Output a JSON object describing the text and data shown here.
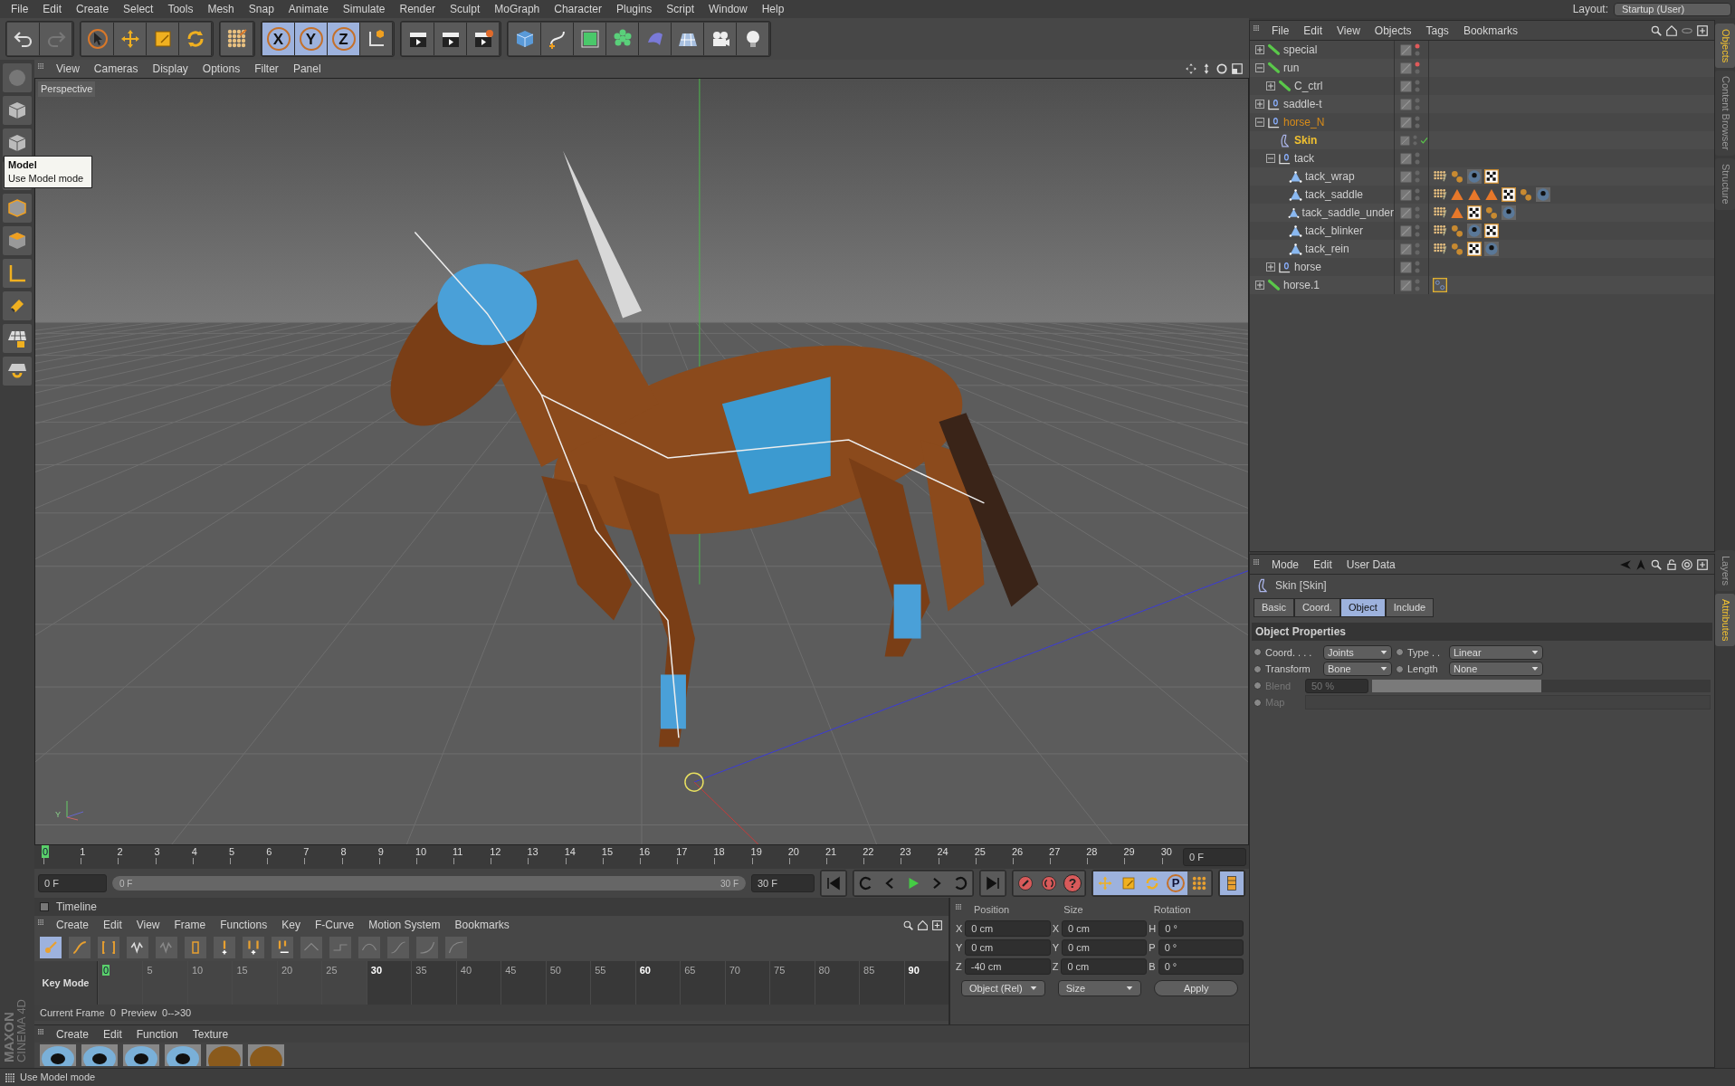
{
  "menu_bar": [
    "File",
    "Edit",
    "Create",
    "Select",
    "Tools",
    "Mesh",
    "Snap",
    "Animate",
    "Simulate",
    "Render",
    "Sculpt",
    "MoGraph",
    "Character",
    "Plugins",
    "Script",
    "Window",
    "Help"
  ],
  "layout": {
    "label": "Layout:",
    "value": "Startup (User)"
  },
  "axis_locks": [
    {
      "label": "X",
      "selected": true
    },
    {
      "label": "Y",
      "selected": true
    },
    {
      "label": "Z",
      "selected": true
    }
  ],
  "tooltip": {
    "title": "Model",
    "text": "Use Model mode"
  },
  "viewport": {
    "menu": [
      "View",
      "Cameras",
      "Display",
      "Options",
      "Filter",
      "Panel"
    ],
    "camera": "Perspective",
    "axis_label": "Y"
  },
  "frame_ruler": {
    "ticks": [
      {
        "label": "0",
        "selected": true
      },
      {
        "label": "1",
        "selected": false
      },
      {
        "label": "2",
        "selected": false
      },
      {
        "label": "3",
        "selected": false
      },
      {
        "label": "4",
        "selected": false
      },
      {
        "label": "5",
        "selected": false
      },
      {
        "label": "6",
        "selected": false
      },
      {
        "label": "7",
        "selected": false
      },
      {
        "label": "8",
        "selected": false
      },
      {
        "label": "9",
        "selected": false
      },
      {
        "label": "10",
        "selected": false
      },
      {
        "label": "11",
        "selected": false
      },
      {
        "label": "12",
        "selected": false
      },
      {
        "label": "13",
        "selected": false
      },
      {
        "label": "14",
        "selected": false
      },
      {
        "label": "15",
        "selected": false
      },
      {
        "label": "16",
        "selected": false
      },
      {
        "label": "17",
        "selected": false
      },
      {
        "label": "18",
        "selected": false
      },
      {
        "label": "19",
        "selected": false
      },
      {
        "label": "20",
        "selected": false
      },
      {
        "label": "21",
        "selected": false
      },
      {
        "label": "22",
        "selected": false
      },
      {
        "label": "23",
        "selected": false
      },
      {
        "label": "24",
        "selected": false
      },
      {
        "label": "25",
        "selected": false
      },
      {
        "label": "26",
        "selected": false
      },
      {
        "label": "27",
        "selected": false
      },
      {
        "label": "28",
        "selected": false
      },
      {
        "label": "29",
        "selected": false
      },
      {
        "label": "30",
        "selected": false
      }
    ],
    "frame": "0 F"
  },
  "range": {
    "start": "0 F",
    "slider_start": "0 F",
    "slider_end": "30 F",
    "level": 1,
    "end": "30 F",
    "help_label": "?",
    "param_label": "P"
  },
  "timeline": {
    "title": "Timeline",
    "menu": [
      "Create",
      "Edit",
      "View",
      "Frame",
      "Functions",
      "Key",
      "F-Curve",
      "Motion System",
      "Bookmarks"
    ],
    "mode": "Key Mode",
    "ticks": [
      {
        "label": "0",
        "selected": true,
        "major": false,
        "in_range": true
      },
      {
        "label": "5",
        "selected": false,
        "major": false,
        "in_range": true
      },
      {
        "label": "10",
        "selected": false,
        "major": false,
        "in_range": true
      },
      {
        "label": "15",
        "selected": false,
        "major": false,
        "in_range": true
      },
      {
        "label": "20",
        "selected": false,
        "major": false,
        "in_range": true
      },
      {
        "label": "25",
        "selected": false,
        "major": false,
        "in_range": true
      },
      {
        "label": "30",
        "selected": false,
        "major": true,
        "in_range": false
      },
      {
        "label": "35",
        "selected": false,
        "major": false,
        "in_range": false
      },
      {
        "label": "40",
        "selected": false,
        "major": false,
        "in_range": false
      },
      {
        "label": "45",
        "selected": false,
        "major": false,
        "in_range": false
      },
      {
        "label": "50",
        "selected": false,
        "major": false,
        "in_range": false
      },
      {
        "label": "55",
        "selected": false,
        "major": false,
        "in_range": false
      },
      {
        "label": "60",
        "selected": false,
        "major": true,
        "in_range": false
      },
      {
        "label": "65",
        "selected": false,
        "major": false,
        "in_range": false
      },
      {
        "label": "70",
        "selected": false,
        "major": false,
        "in_range": false
      },
      {
        "label": "75",
        "selected": false,
        "major": false,
        "in_range": false
      },
      {
        "label": "80",
        "selected": false,
        "major": false,
        "in_range": false
      },
      {
        "label": "85",
        "selected": false,
        "major": false,
        "in_range": false
      },
      {
        "label": "90",
        "selected": false,
        "major": true,
        "in_range": false
      }
    ],
    "status": "Current Frame  0  Preview  0-->30"
  },
  "coordinates": {
    "headers": [
      "Position",
      "Size",
      "Rotation"
    ],
    "rows": [
      [
        {
          "axis": "X",
          "value": "0 cm"
        },
        {
          "axis": "X",
          "value": "0 cm"
        },
        {
          "axis": "H",
          "value": "0 °"
        }
      ],
      [
        {
          "axis": "Y",
          "value": "0 cm"
        },
        {
          "axis": "Y",
          "value": "0 cm"
        },
        {
          "axis": "P",
          "value": "0 °"
        }
      ],
      [
        {
          "axis": "Z",
          "value": "-40 cm"
        },
        {
          "axis": "Z",
          "value": "0 cm"
        },
        {
          "axis": "B",
          "value": "0 °"
        }
      ]
    ],
    "dropdowns": [
      "Object (Rel)",
      "Size"
    ],
    "apply": "Apply"
  },
  "materials": {
    "menu": [
      "Create",
      "Edit",
      "Function",
      "Texture"
    ],
    "items": [
      {
        "kind": "eye"
      },
      {
        "kind": "eye"
      },
      {
        "kind": "eye"
      },
      {
        "kind": "eye"
      },
      {
        "kind": "fur"
      },
      {
        "kind": "fur"
      }
    ]
  },
  "objects": {
    "menu": [
      "File",
      "Edit",
      "View",
      "Objects",
      "Tags",
      "Bookmarks"
    ],
    "tree": [
      {
        "name": "special",
        "kind": "joint",
        "expanded": false,
        "selected": false,
        "highlighted": false,
        "hidden": true,
        "checked": false
      },
      {
        "name": "run",
        "kind": "joint",
        "expanded": true,
        "selected": false,
        "highlighted": false,
        "hidden": true,
        "checked": false,
        "children": [
          {
            "name": "C_ctrl",
            "kind": "joint",
            "expanded": false,
            "selected": false,
            "highlighted": false,
            "hidden": false,
            "checked": false
          }
        ]
      },
      {
        "name": "saddle-t",
        "kind": "null",
        "expanded": false,
        "selected": false,
        "highlighted": false,
        "hidden": false,
        "checked": false
      },
      {
        "name": "horse_N",
        "kind": "null",
        "expanded": true,
        "selected": false,
        "highlighted": true,
        "hidden": false,
        "checked": false,
        "children": [
          {
            "name": "Skin",
            "kind": "skin",
            "selected": true,
            "highlighted": false,
            "hidden": false,
            "checked": true
          },
          {
            "name": "tack",
            "kind": "null",
            "expanded": true,
            "selected": false,
            "highlighted": false,
            "hidden": false,
            "checked": false,
            "children": [
              {
                "name": "tack_wrap",
                "kind": "polygon",
                "selected": false,
                "highlighted": false,
                "hidden": false,
                "checked": false,
                "tags": [
                  {
                    "kind": "weight"
                  },
                  {
                    "kind": "points"
                  },
                  {
                    "kind": "material"
                  },
                  {
                    "kind": "texture"
                  }
                ]
              },
              {
                "name": "tack_saddle",
                "kind": "polygon",
                "selected": false,
                "highlighted": false,
                "hidden": false,
                "checked": false,
                "tags": [
                  {
                    "kind": "weight"
                  },
                  {
                    "kind": "triangle"
                  },
                  {
                    "kind": "triangle"
                  },
                  {
                    "kind": "triangle"
                  },
                  {
                    "kind": "texture"
                  },
                  {
                    "kind": "points"
                  },
                  {
                    "kind": "material"
                  }
                ]
              },
              {
                "name": "tack_saddle_under",
                "kind": "polygon",
                "selected": false,
                "highlighted": false,
                "hidden": false,
                "checked": false,
                "tags": [
                  {
                    "kind": "weight"
                  },
                  {
                    "kind": "triangle"
                  },
                  {
                    "kind": "texture"
                  },
                  {
                    "kind": "points"
                  },
                  {
                    "kind": "material"
                  }
                ]
              },
              {
                "name": "tack_blinker",
                "kind": "polygon",
                "selected": false,
                "highlighted": false,
                "hidden": false,
                "checked": false,
                "tags": [
                  {
                    "kind": "weight"
                  },
                  {
                    "kind": "points"
                  },
                  {
                    "kind": "material"
                  },
                  {
                    "kind": "texture"
                  }
                ]
              },
              {
                "name": "tack_rein",
                "kind": "polygon",
                "selected": false,
                "highlighted": false,
                "hidden": false,
                "checked": false,
                "tags": [
                  {
                    "kind": "weight"
                  },
                  {
                    "kind": "points"
                  },
                  {
                    "kind": "texture"
                  },
                  {
                    "kind": "material"
                  }
                ]
              }
            ]
          },
          {
            "name": "horse",
            "kind": "null",
            "expanded": false,
            "selected": false,
            "highlighted": false,
            "hidden": false,
            "checked": false
          }
        ]
      },
      {
        "name": "horse.1",
        "kind": "joint",
        "expanded": false,
        "selected": false,
        "highlighted": false,
        "hidden": false,
        "checked": false,
        "tags": [
          {
            "kind": "target"
          }
        ]
      }
    ]
  },
  "attributes": {
    "menu": [
      "Mode",
      "Edit",
      "User Data"
    ],
    "title": "Skin [Skin]",
    "tabs": [
      {
        "label": "Basic",
        "selected": false
      },
      {
        "label": "Coord.",
        "selected": false
      },
      {
        "label": "Object",
        "selected": true
      },
      {
        "label": "Include",
        "selected": false
      }
    ],
    "section": "Object Properties",
    "rows": [
      [
        {
          "label": "Coord. . . .",
          "value": "Joints",
          "animated": false
        },
        {
          "label": "Type . .",
          "value": "Linear",
          "animated": false
        }
      ],
      [
        {
          "label": "Transform",
          "value": "Bone",
          "animated": false
        },
        {
          "label": "Length",
          "value": "None",
          "animated": false
        }
      ]
    ],
    "blend": {
      "label": "Blend",
      "value": "50 %",
      "level": 0.5,
      "disabled": true,
      "animated": false
    },
    "map": {
      "label": "Map",
      "disabled": true,
      "animated": false
    }
  },
  "side_tabs_top": [
    {
      "label": "Objects",
      "selected": true
    },
    {
      "label": "Content Browser",
      "selected": false
    },
    {
      "label": "Structure",
      "selected": false
    }
  ],
  "side_tabs_bottom": [
    {
      "label": "Layers",
      "selected": false
    },
    {
      "label": "Attributes",
      "selected": true
    }
  ],
  "status_bar": "Use Model mode",
  "logo": {
    "brand": "MAXON",
    "product": "CINEMA 4D"
  }
}
